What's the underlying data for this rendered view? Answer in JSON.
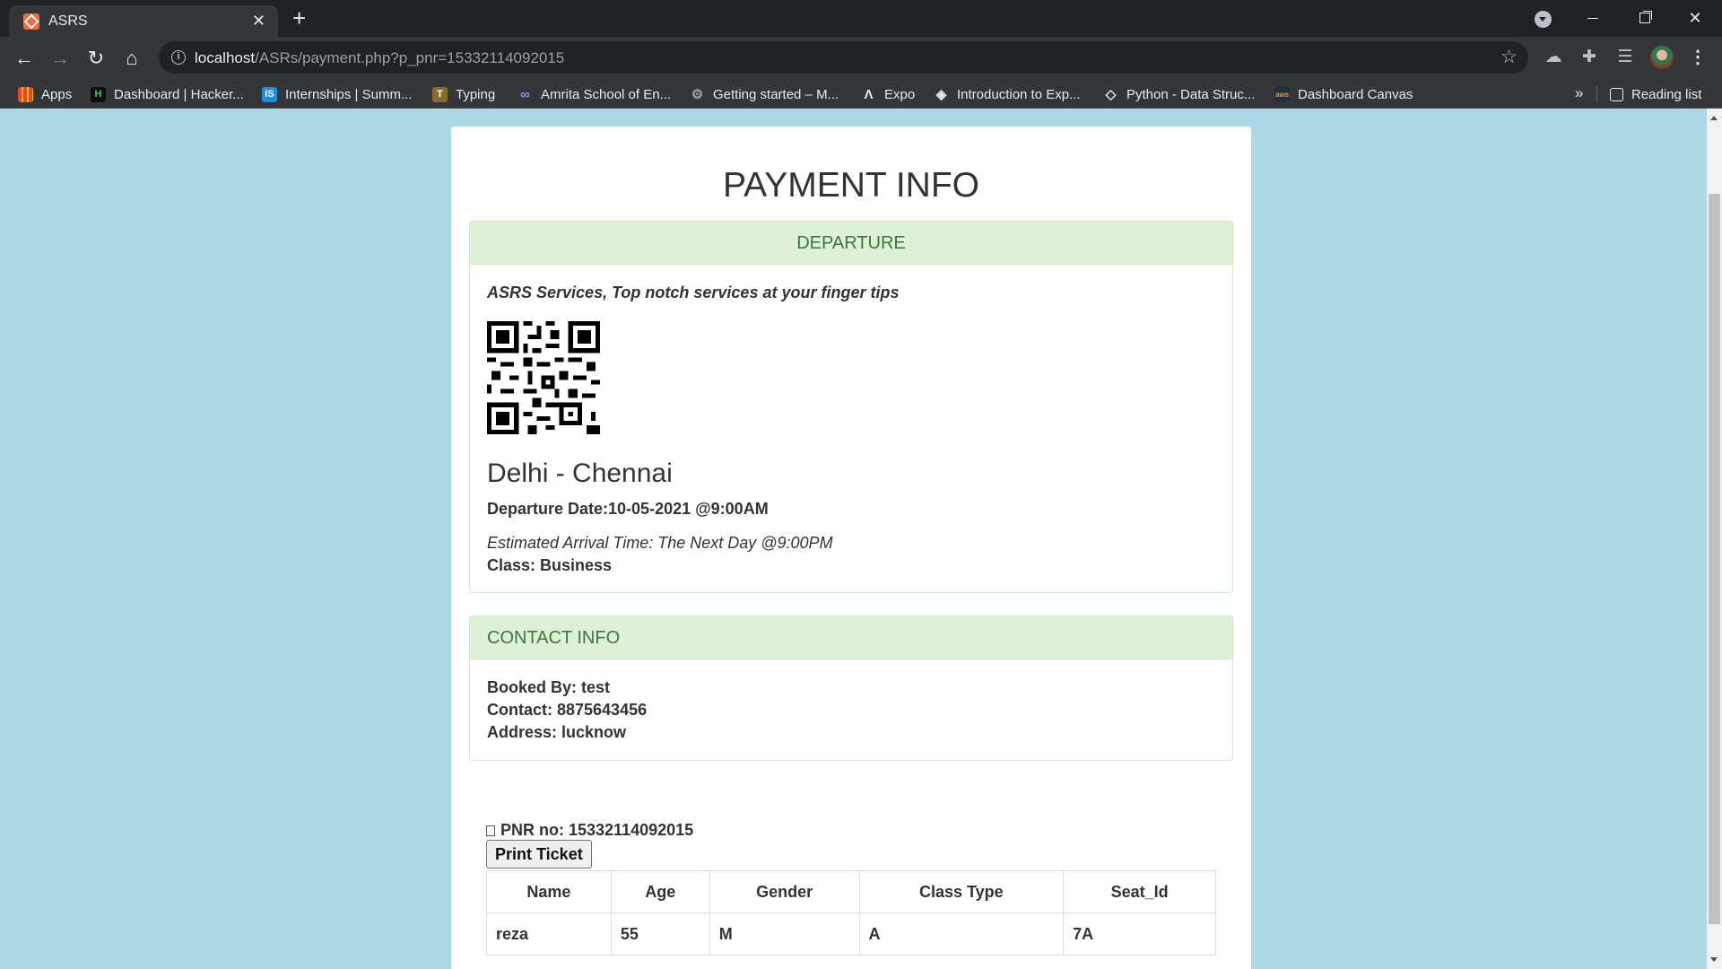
{
  "browser": {
    "tab_title": "ASRS",
    "url_host": "localhost",
    "url_path": "/ASRs/payment.php?p_pnr=15332114092015",
    "bookmarks": [
      {
        "label": "Apps",
        "icon": "apps-grid-icon",
        "color": "#4285f4"
      },
      {
        "label": "Dashboard | Hacker...",
        "icon": "hackerrank-icon",
        "color": "#1a1a1a"
      },
      {
        "label": "Internships | Summ...",
        "icon": "internshala-icon",
        "color": "#1a8fe3"
      },
      {
        "label": "Typing",
        "icon": "typing-icon",
        "color": "#6b5a2a"
      },
      {
        "label": "Amrita School of En...",
        "icon": "amrita-icon",
        "color": "#5b7ad6"
      },
      {
        "label": "Getting started – M...",
        "icon": "mdn-icon",
        "color": "#5f6368"
      },
      {
        "label": "Expo",
        "icon": "expo-icon",
        "color": "#1a1a1a"
      },
      {
        "label": "Introduction to Exp...",
        "icon": "intro-express-icon",
        "color": "#5f6368"
      },
      {
        "label": "Python - Data Struc...",
        "icon": "python-ds-icon",
        "color": "#5f6368"
      },
      {
        "label": "Dashboard Canvas",
        "icon": "aws-canvas-icon",
        "color": "#232f3e"
      }
    ],
    "reading_list": "Reading list",
    "more": "»"
  },
  "page": {
    "title": "PAYMENT INFO",
    "departure": {
      "heading": "DEPARTURE",
      "tagline": "ASRS Services, Top notch services at your finger tips",
      "route": "Delhi - Chennai",
      "departure_date": "Departure Date:10-05-2021 @9:00AM",
      "arrival": "Estimated Arrival Time: The Next Day @9:00PM",
      "class": "Class: Business"
    },
    "contact": {
      "heading": "CONTACT INFO",
      "booked_by": "Booked By: test",
      "contact": "Contact: 8875643456",
      "address": "Address: lucknow"
    },
    "pnr": "PNR no: 15332114092015",
    "print_label": "Print Ticket",
    "table": {
      "headers": [
        "Name",
        "Age",
        "Gender",
        "Class Type",
        "Seat_Id"
      ],
      "rows": [
        [
          "reza",
          "55",
          "M",
          "A",
          "7A"
        ]
      ]
    }
  },
  "colors": {
    "page_bg": "#add8e6",
    "panel_head_bg": "#dff0d8",
    "panel_head_text": "#3c763d"
  }
}
